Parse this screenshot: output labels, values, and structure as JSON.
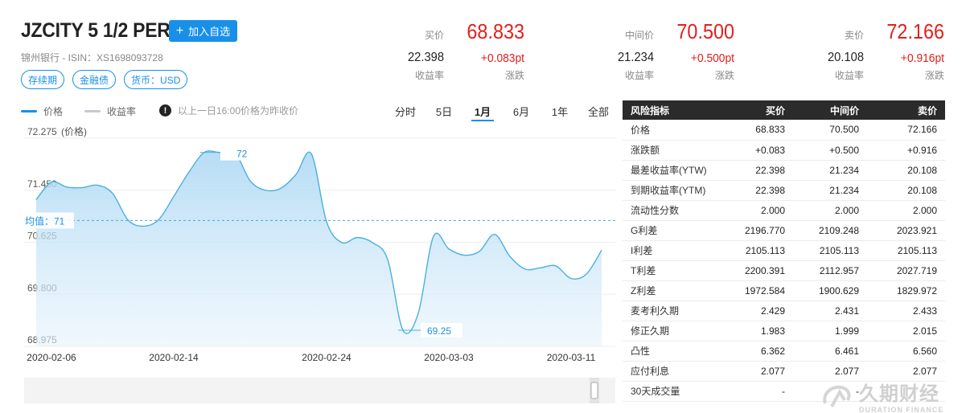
{
  "header": {
    "bond_name": "JZCITY 5 1/2 PERP",
    "watch_button": "加入自选",
    "issuer_isin": "锦州银行 - ISIN：XS1698093728",
    "tags": [
      "存续期",
      "金融债",
      "货币：USD"
    ]
  },
  "quotes": {
    "bid": {
      "label": "买价",
      "price": "68.833",
      "yield": "22.398",
      "yield_label": "收益率",
      "change": "+0.083pt",
      "change_label": "涨跌"
    },
    "mid": {
      "label": "中间价",
      "price": "70.500",
      "yield": "21.234",
      "yield_label": "收益率",
      "change": "+0.500pt",
      "change_label": "涨跌"
    },
    "ask": {
      "label": "卖价",
      "price": "72.166",
      "yield": "20.108",
      "yield_label": "收益率",
      "change": "+0.916pt",
      "change_label": "涨跌"
    }
  },
  "chart_controls": {
    "legend_price": "价格",
    "legend_yield": "收益率",
    "note": "以上一日16:00价格为昨收价",
    "periods": [
      "分时",
      "5日",
      "1月",
      "6月",
      "1年",
      "全部"
    ],
    "active_period": "1月"
  },
  "colors": {
    "accent": "#1890e8",
    "up_red": "#e0201c",
    "line": "#4ab0e0",
    "table_header": "#2b2b2b"
  },
  "chart_data": {
    "type": "area",
    "ylabel": "(价格)",
    "y_ticks": [
      "72.275",
      "71.450",
      "70.625",
      "69.800",
      "68.975"
    ],
    "ylim": [
      68.975,
      72.275
    ],
    "x_ticks": [
      "2020-02-06",
      "2020-02-14",
      "2020-02-24",
      "2020-03-03",
      "2020-03-11"
    ],
    "x_tick_index": [
      1,
      9,
      19,
      27,
      35
    ],
    "average_label": "均值：71",
    "average": 70.97,
    "max_label": "72",
    "min_label": "69.25",
    "series": [
      {
        "values": [
          71.3,
          71.58,
          71.5,
          71.49,
          71.53,
          71.4,
          70.98,
          70.88,
          70.98,
          71.35,
          71.74,
          72.05,
          72.05,
          72.05,
          71.6,
          71.45,
          71.48,
          71.7,
          72.03,
          70.95,
          70.62,
          70.7,
          70.62,
          70.35,
          69.23,
          69.5,
          70.72,
          70.52,
          70.42,
          70.48,
          70.75,
          70.4,
          70.2,
          70.22,
          70.25,
          70.05,
          70.12,
          70.5
        ]
      }
    ]
  },
  "risk_table": {
    "headers": [
      "风险指标",
      "买价",
      "中间价",
      "卖价"
    ],
    "rows": [
      [
        "价格",
        "68.833",
        "70.500",
        "72.166"
      ],
      [
        "涨跌额",
        "+0.083",
        "+0.500",
        "+0.916"
      ],
      [
        "最差收益率(YTW)",
        "22.398",
        "21.234",
        "20.108"
      ],
      [
        "到期收益率(YTM)",
        "22.398",
        "21.234",
        "20.108"
      ],
      [
        "流动性分数",
        "2.000",
        "2.000",
        "2.000"
      ],
      [
        "G利差",
        "2196.770",
        "2109.248",
        "2023.921"
      ],
      [
        "I利差",
        "2105.113",
        "2105.113",
        "2105.113"
      ],
      [
        "T利差",
        "2200.391",
        "2112.957",
        "2027.719"
      ],
      [
        "Z利差",
        "1972.584",
        "1900.629",
        "1829.972"
      ],
      [
        "麦考利久期",
        "2.429",
        "2.431",
        "2.433"
      ],
      [
        "修正久期",
        "1.983",
        "1.999",
        "2.015"
      ],
      [
        "凸性",
        "6.362",
        "6.461",
        "6.560"
      ],
      [
        "应付利息",
        "2.077",
        "2.077",
        "2.077"
      ],
      [
        "30天成交量",
        "-",
        "-",
        "-"
      ]
    ]
  },
  "watermark": {
    "cn": "久期财经",
    "en": "DURATION FINANCE"
  }
}
